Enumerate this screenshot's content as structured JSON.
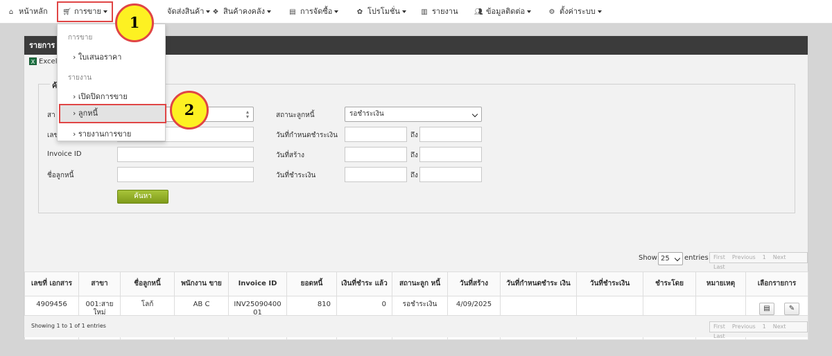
{
  "nav": {
    "home": "หน้าหลัก",
    "sales": "การขาย",
    "delivery": "จัดส่งสินค้า",
    "inventory": "สินค้าคงคลัง",
    "purchase": "การจัดซื้อ",
    "promotion": "โปรโมชั่น",
    "report": "รายงาน",
    "contacts": "ข้อมูลติดต่อ",
    "settings": "ตั้งค่าระบบ"
  },
  "dropdown": {
    "header_sales": "การขาย",
    "quotation": "› ใบเสนอราคา",
    "header_report": "รายงาน",
    "open_close": "› เปิดปิดการขาย",
    "debtor": "› ลูกหนี้",
    "sales_report": "› รายงานการขาย"
  },
  "badges": {
    "one": "1",
    "two": "2"
  },
  "panel": {
    "title": "รายการ",
    "excel": "Excel"
  },
  "filters": {
    "legend": "ค้",
    "branch_label": "สา",
    "docno_label": "เลข",
    "invoice_label": "Invoice ID",
    "debtor_name_label": "ชื่อลูกหนี้",
    "status_label": "สถานะลูกหนี้",
    "status_value": "รอชำระเงิน",
    "due_label": "วันที่กำหนดชำระเงิน",
    "created_label": "วันที่สร้าง",
    "paid_label": "วันที่ชำระเงิน",
    "to": "ถึง",
    "search": "ค้นหา"
  },
  "list": {
    "show": "Show",
    "entries_value": "25",
    "entries": "entries",
    "first": "First",
    "previous": "Previous",
    "page": "1",
    "next": "Next",
    "last": "Last",
    "info": "Showing 1 to 1 of 1 entries"
  },
  "table": {
    "headers": [
      "เลขที่ เอกสาร",
      "สาขา",
      "ชื่อลูกหนี้",
      "พนักงาน ขาย",
      "Invoice ID",
      "ยอดหนี้",
      "เงินที่ชำระ แล้ว",
      "สถานะลูก หนี้",
      "วันที่สร้าง",
      "วันที่กำหนดชำระ เงิน",
      "วันที่ชำระเงิน",
      "ชำระโดย",
      "หมายเหตุ",
      "เลือกรายการ"
    ],
    "row": {
      "doc_no": "4909456",
      "branch": "001:สาย ใหม่",
      "debtor": "โลก้",
      "staff": "AB C",
      "invoice": "INV25090400 01",
      "amount": "810",
      "paid": "0",
      "status": "รอชำระเงิน",
      "created": "4/09/2025",
      "due": "",
      "paid_date": "",
      "paid_by": "",
      "note": ""
    }
  },
  "colors": {
    "highlight": "#e04545",
    "badge": "#fdf122",
    "search_button": "#8eab22",
    "header_bar": "#3b3b3b"
  }
}
